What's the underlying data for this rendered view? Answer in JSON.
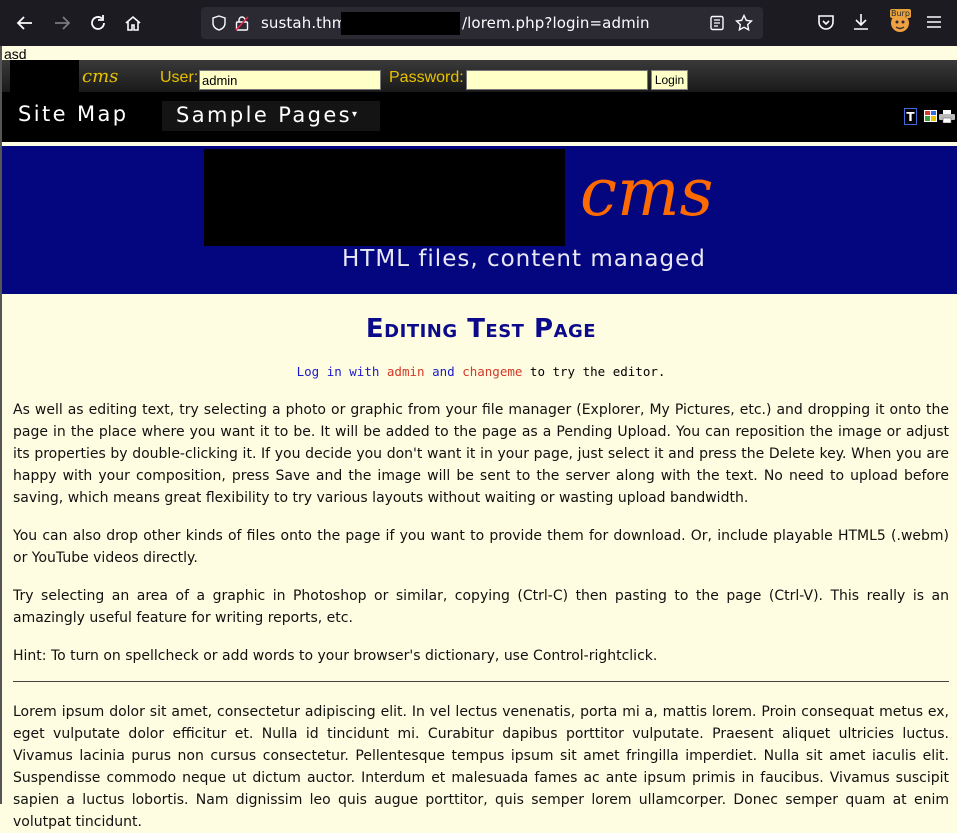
{
  "browser": {
    "url_host": "sustah.thm/",
    "url_path": "/lorem.php?login=admin",
    "burp_badge": "Burp",
    "icons": [
      "back-icon",
      "forward-icon",
      "reload-icon",
      "home-icon",
      "shield-icon",
      "lock-icon",
      "reader-view-icon",
      "bookmark-star-icon",
      "pocket-icon",
      "downloads-icon",
      "burp-extension-icon",
      "hamburger-menu-icon"
    ]
  },
  "page": {
    "stray_text": "asd",
    "login": {
      "logo_text": "cms",
      "user_label": "User:",
      "user_value": "admin",
      "password_label": "Password:",
      "password_value": "",
      "login_button": "Login"
    },
    "menu": {
      "site_map": "Site Map",
      "sample_pages": "Sample Pages",
      "caret": "▾",
      "t_button": "T"
    },
    "banner": {
      "cms": "cms",
      "tagline": "HTML files, content managed"
    },
    "title": "Editing Test Page",
    "hint": {
      "prefix": "Log in with ",
      "user": "admin",
      "and": " and ",
      "password": "changeme",
      "suffix": " to try the editor."
    },
    "paragraphs": [
      "As well as editing text, try selecting a photo or graphic from your file manager (Explorer, My Pictures, etc.) and dropping it onto the page in the place where you want it to be.  It will be added to the page as a Pending Upload. You can reposition the image or adjust its properties by double-clicking it. If you decide you don't want it in your page, just select it and press the Delete key.  When you are happy with your composition, press Save and the image will be sent to the server along with the text. No need to upload before saving, which means great flexibility to try various layouts without waiting or wasting upload bandwidth.",
      "You can also drop other kinds of files onto the page if you want to provide them for download. Or, include playable HTML5 (.webm) or YouTube videos directly.",
      "Try selecting an area of a graphic in Photoshop or similar, copying (Ctrl-C) then pasting to the page (Ctrl-V). This really is an amazingly useful feature for writing reports, etc.",
      "Hint: To turn on spellcheck or add words to your browser's dictionary, use Control-rightclick.",
      "Lorem ipsum dolor sit amet, consectetur adipiscing elit. In vel lectus venenatis, porta mi a, mattis lorem. Proin consequat metus ex, eget vulputate dolor efficitur et. Nulla id tincidunt mi. Curabitur dapibus porttitor vulputate. Praesent aliquet ultricies luctus. Vivamus lacinia purus non cursus consectetur. Pellentesque tempus ipsum sit amet fringilla imperdiet. Nulla sit amet iaculis elit. Suspendisse commodo neque ut dictum auctor. Interdum et malesuada fames ac ante ipsum primis in faucibus. Vivamus suscipit sapien a luctus lobortis. Nam dignissim leo quis augue porttitor, quis semper lorem ullamcorper. Donec semper quam at enim volutpat tincidunt."
    ]
  }
}
